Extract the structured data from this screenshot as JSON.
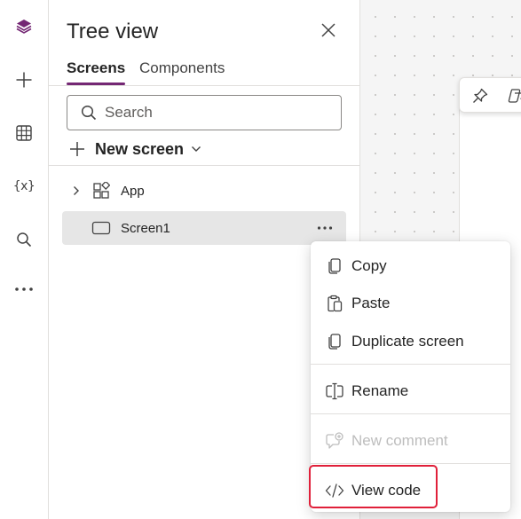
{
  "panel": {
    "title": "Tree view",
    "tabs": [
      {
        "label": "Screens",
        "selected": true
      },
      {
        "label": "Components",
        "selected": false
      }
    ],
    "search": {
      "placeholder": "Search",
      "value": ""
    },
    "new_screen_label": "New screen",
    "tree": [
      {
        "label": "App",
        "icon": "app-icon",
        "expandable": true
      },
      {
        "label": "Screen1",
        "icon": "screen-icon",
        "selected": true
      }
    ]
  },
  "rail": {
    "items": [
      "layers-icon",
      "plus-icon",
      "table-icon",
      "variables-icon",
      "search-icon",
      "more-icon"
    ],
    "variables_glyph": "{x}"
  },
  "context_menu": {
    "items": [
      {
        "label": "Copy",
        "icon": "copy-icon",
        "enabled": true
      },
      {
        "label": "Paste",
        "icon": "paste-icon",
        "enabled": true
      },
      {
        "label": "Duplicate screen",
        "icon": "duplicate-icon",
        "enabled": true
      },
      {
        "label": "Rename",
        "icon": "rename-icon",
        "enabled": true
      },
      {
        "label": "New comment",
        "icon": "comment-icon",
        "enabled": false
      },
      {
        "label": "View code",
        "icon": "code-icon",
        "enabled": true,
        "highlighted": true
      }
    ]
  },
  "colors": {
    "accent": "#742774",
    "highlight_border": "#e0203a",
    "selected_row": "#e6e6e6",
    "disabled_text": "#bdbdbd"
  }
}
